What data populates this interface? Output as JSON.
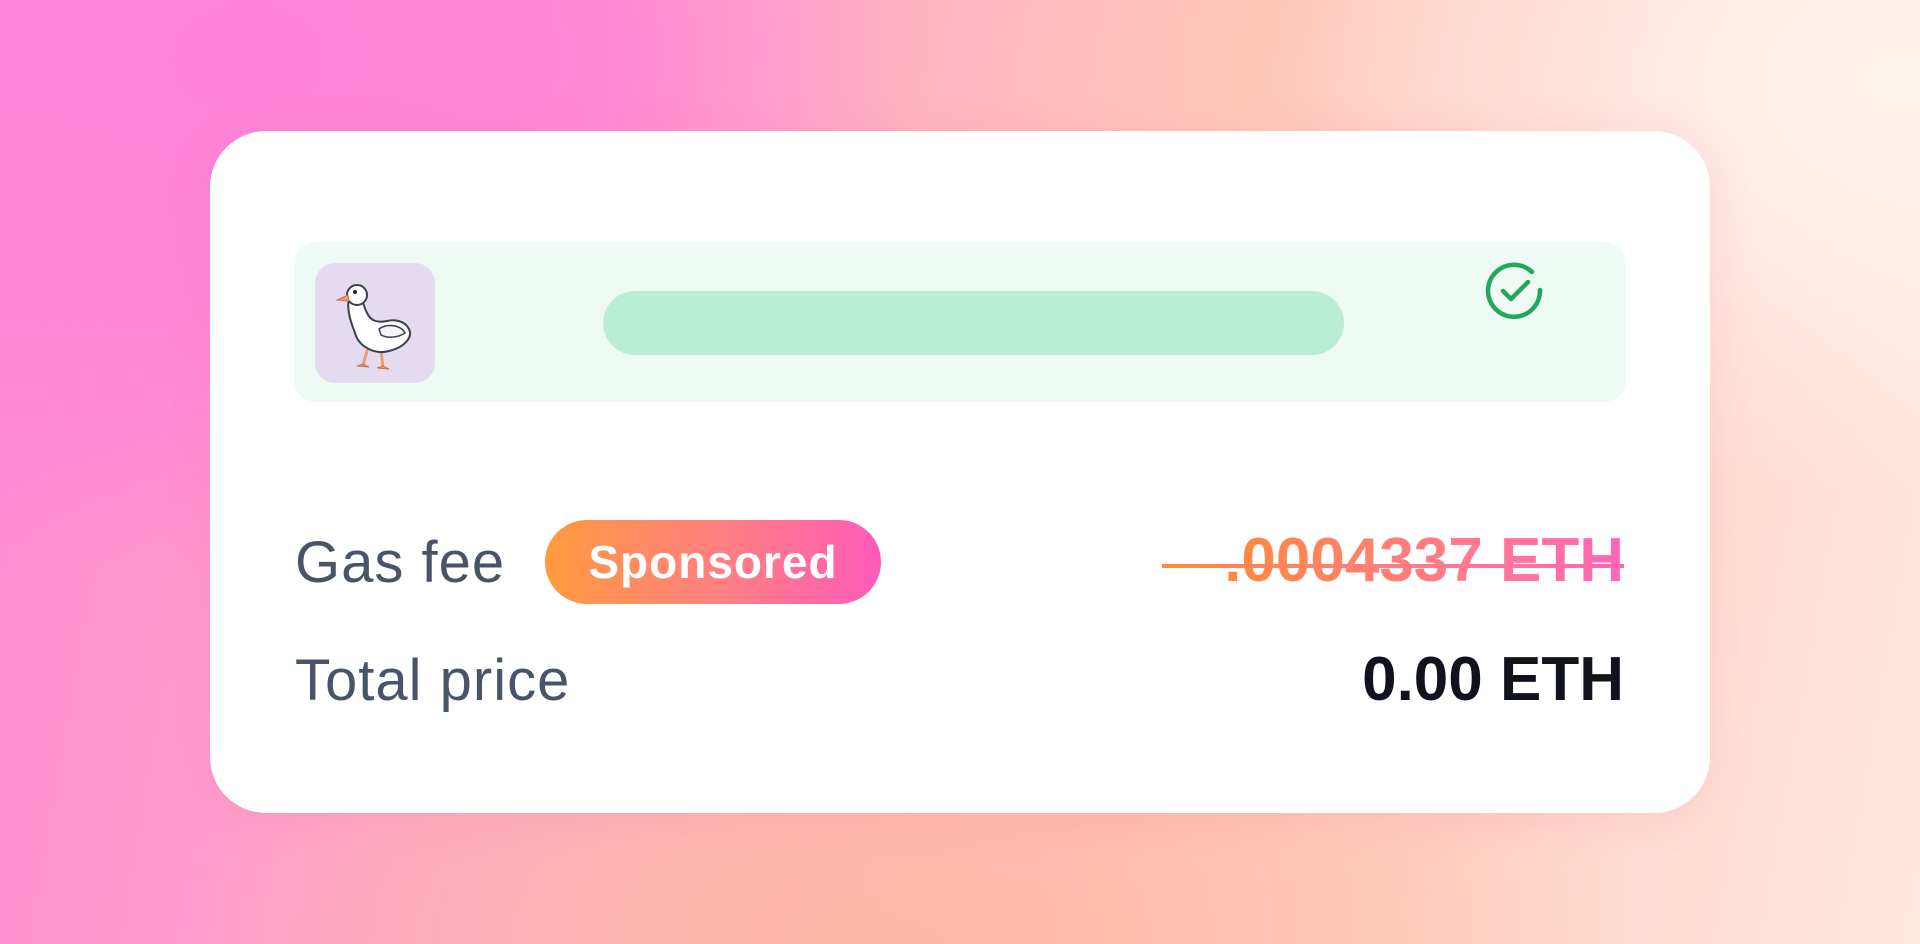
{
  "summary": {
    "item": {
      "thumbnail_icon": "goose-icon",
      "status_icon": "check-circle-icon",
      "status_color": "#22a85a",
      "loading_bar_color": "#b9eed4"
    },
    "gas_fee": {
      "label": "Gas fee",
      "badge": "Sponsored",
      "original_value": ".0004337 ETH"
    },
    "total": {
      "label": "Total price",
      "value": "0.00 ETH"
    }
  },
  "colors": {
    "accent_start": "#ff9a3d",
    "accent_end": "#ff5ab8",
    "text_muted": "#4a5468",
    "text_strong": "#10131e"
  }
}
